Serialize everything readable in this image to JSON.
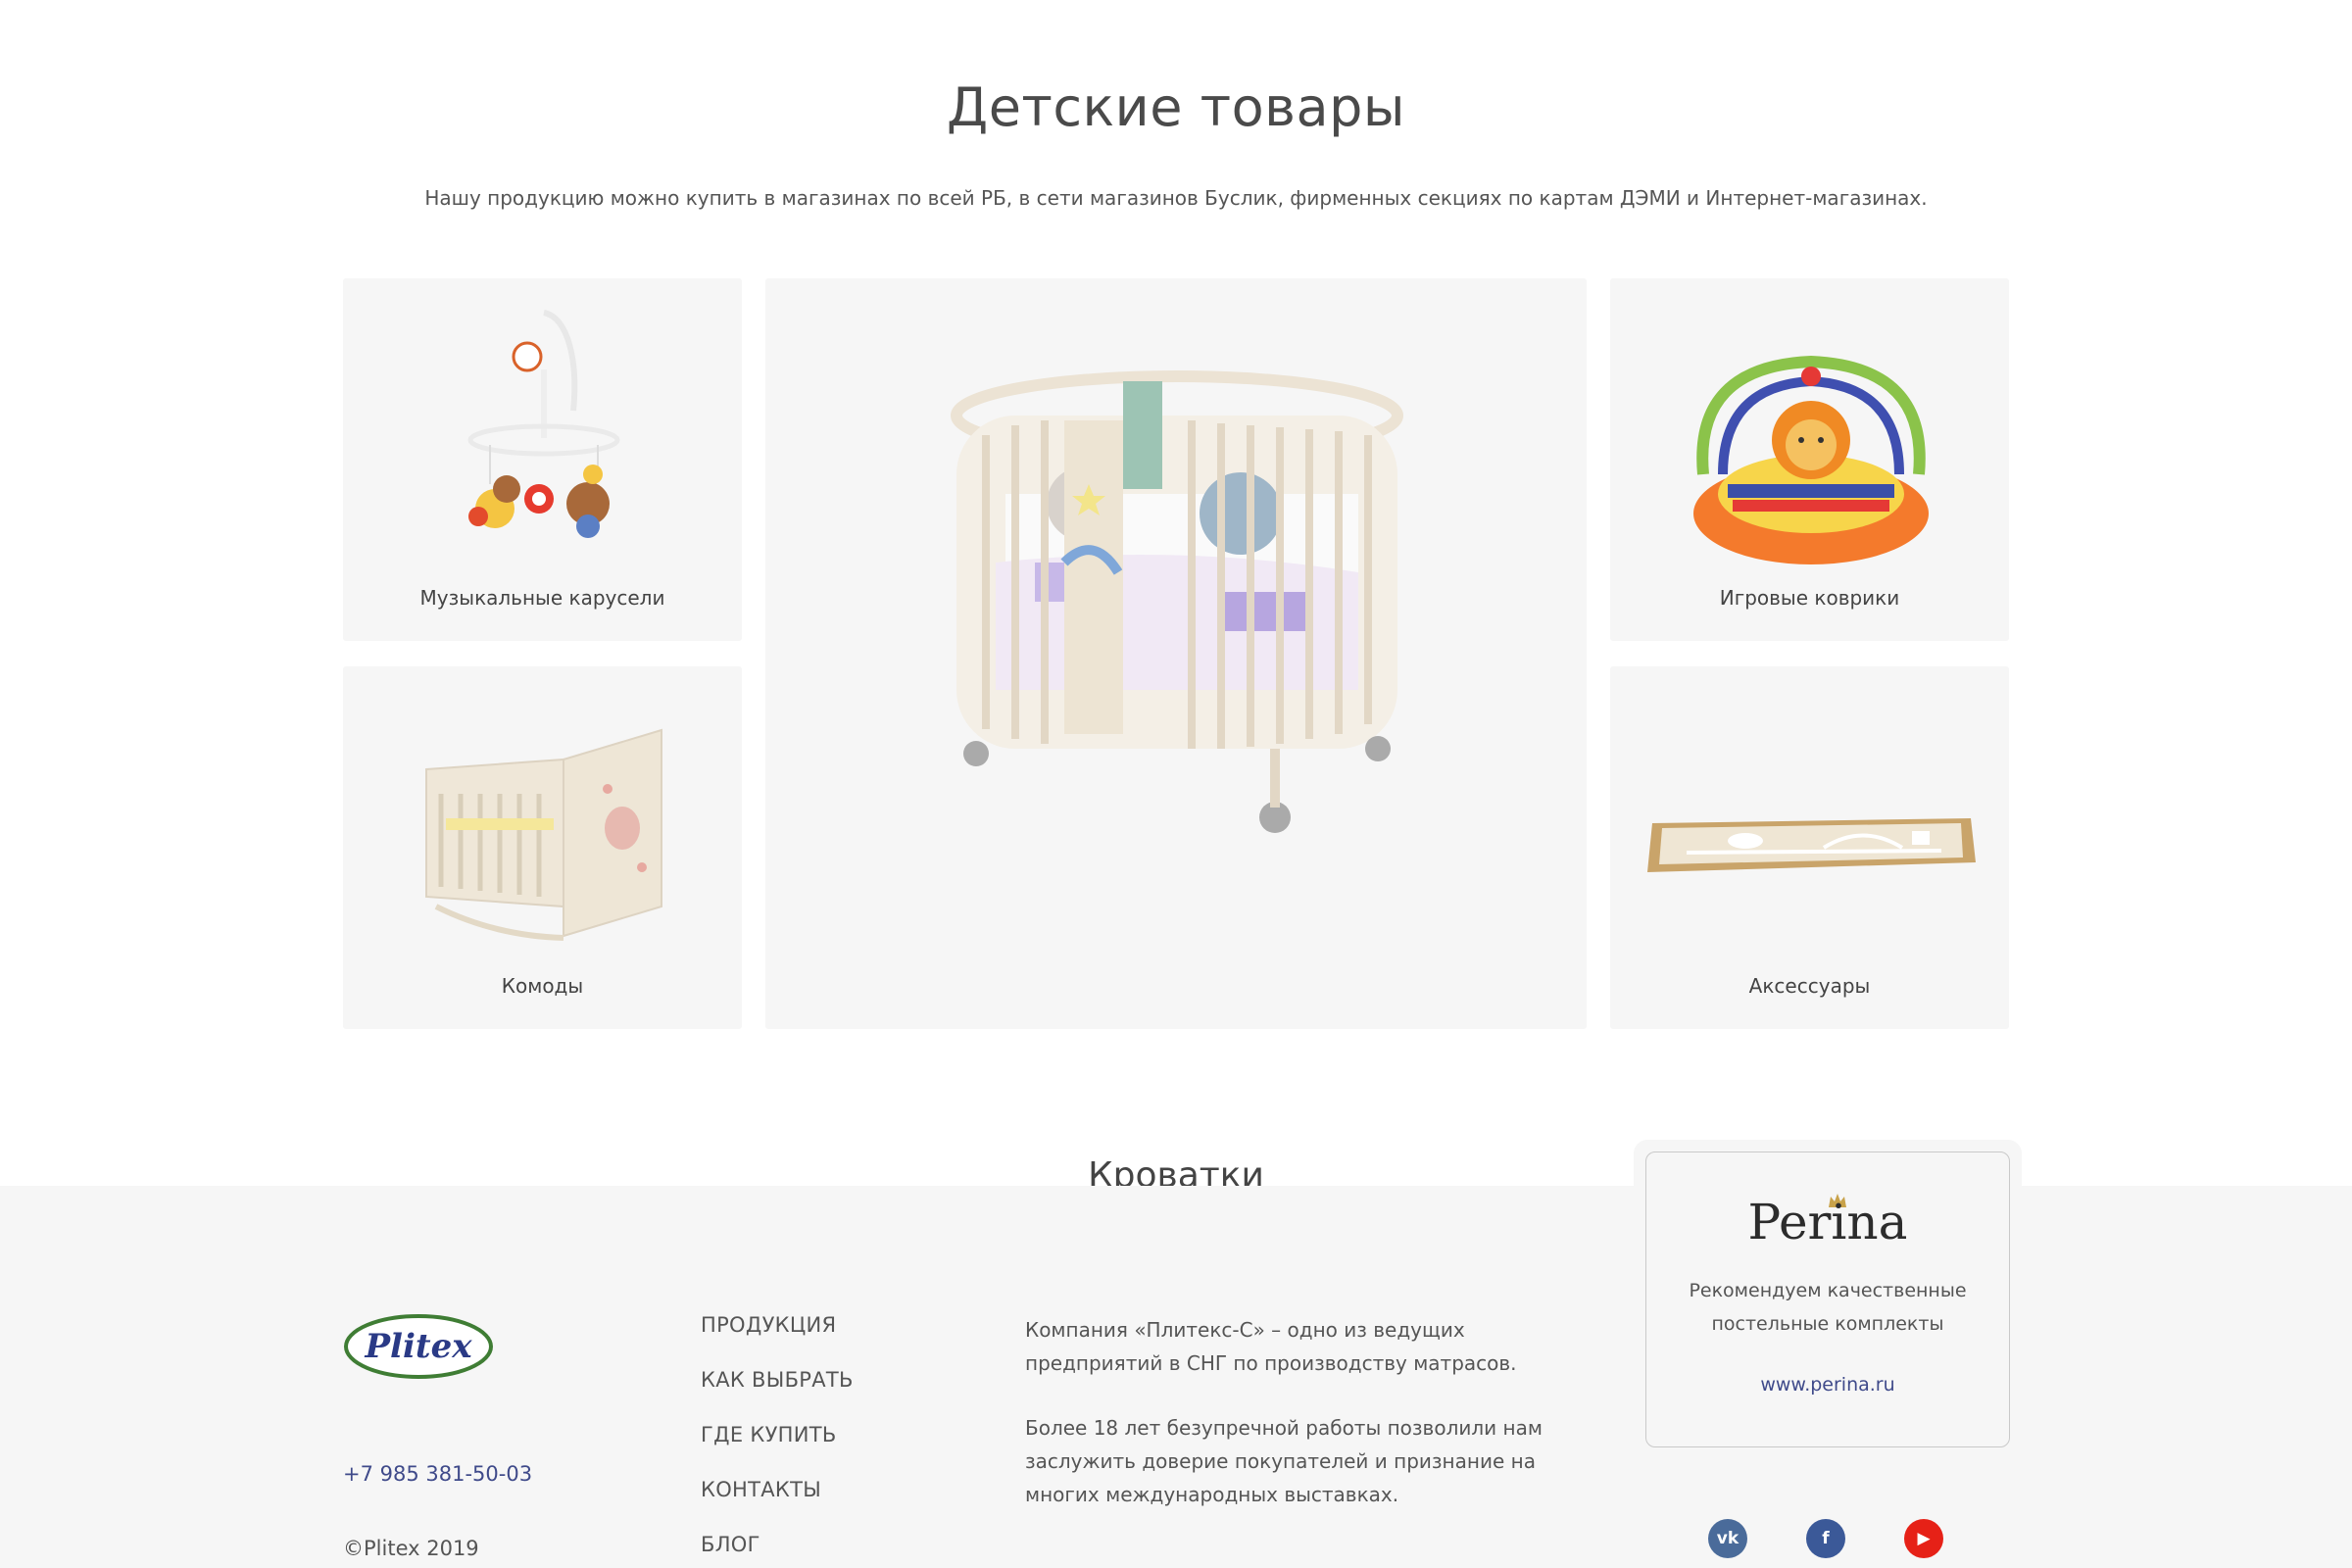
{
  "section": {
    "title": "Детские товары",
    "subtitle": "Нашу продукцию можно купить в магазинах по всей РБ, в сети магазинов Буслик, фирменных секциях по картам ДЭМИ и Интернет-магазинах."
  },
  "categories": [
    {
      "label": "Музыкальные карусели",
      "icon": "mobile-toy-image"
    },
    {
      "label": "Комоды",
      "icon": "dresser-crib-image"
    },
    {
      "label": "Кроватки",
      "icon": "crib-image"
    },
    {
      "label": "Игровые коврики",
      "icon": "playmat-image"
    },
    {
      "label": "Аксессуары",
      "icon": "accessory-box-image"
    }
  ],
  "footer": {
    "logo_text": "Plitex",
    "phone": "+7 985 381-50-03",
    "copyright": "©Plitex 2019",
    "nav": [
      "ПРОДУКЦИЯ",
      "КАК ВЫБРАТЬ",
      "ГДЕ КУПИТЬ",
      "КОНТАКТЫ",
      "БЛОГ"
    ],
    "about": [
      "Компания «Плитекс-С» – одно из ведущих предприятий в СНГ по производству матрасов.",
      "Более 18 лет безупречной работы позволили нам заслужить доверие покупателей и признание на многих международных выставках."
    ],
    "partner": {
      "name": "Perina",
      "text": "Рекомендуем качественные постельные комплекты",
      "link": "www.perina.ru"
    },
    "social": [
      {
        "name": "vk-icon",
        "glyph": "vk",
        "color": "#4a6b9a"
      },
      {
        "name": "facebook-icon",
        "glyph": "f",
        "color": "#3b5998"
      },
      {
        "name": "youtube-icon",
        "glyph": "▶",
        "color": "#e62117"
      }
    ]
  },
  "colors": {
    "card_bg": "#f6f6f6",
    "link": "#3f4a8a",
    "logo_green": "#3f7d34",
    "logo_blue": "#2a3a86"
  }
}
